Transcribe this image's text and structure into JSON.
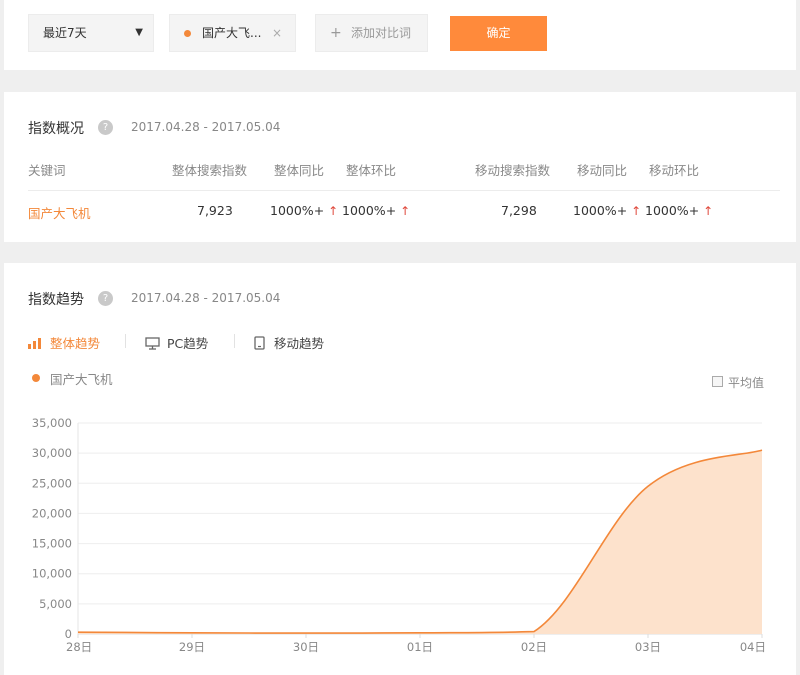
{
  "toolbar": {
    "range_select": "最近7天",
    "caret": "▼",
    "keyword_chip": "国产大飞...",
    "chip_close": "×",
    "add_plus": "+",
    "add_compare": "添加对比词",
    "confirm": "确定"
  },
  "overview": {
    "title": "指数概况",
    "help": "?",
    "date_range": "2017.04.28 - 2017.05.04",
    "headers": [
      "关键词",
      "整体搜索指数",
      "整体同比",
      "整体环比",
      "移动搜索指数",
      "移动同比",
      "移动环比"
    ],
    "row": {
      "keyword": "国产大飞机",
      "overall_index": "7,923",
      "overall_yoy": "1000%+",
      "overall_mom": "1000%+",
      "mobile_index": "7,298",
      "mobile_yoy": "1000%+",
      "mobile_mom": "1000%+",
      "up_arrow": "↑"
    }
  },
  "trend": {
    "title": "指数趋势",
    "help": "?",
    "date_range": "2017.04.28 - 2017.05.04",
    "tabs": [
      {
        "label": "整体趋势",
        "icon": "bar-chart-icon"
      },
      {
        "label": "PC趋势",
        "icon": "monitor-icon"
      },
      {
        "label": "移动趋势",
        "icon": "mobile-icon"
      }
    ],
    "legend": "国产大飞机",
    "average_label": "平均值"
  },
  "colors": {
    "accent": "#f3883a",
    "button": "#ff8a3b",
    "up_arrow": "#e0483b",
    "area_fill": "#fde2cc"
  },
  "chart_data": {
    "type": "area",
    "x": [
      "28日",
      "29日",
      "30日",
      "01日",
      "02日",
      "03日",
      "04日"
    ],
    "series": [
      {
        "name": "国产大飞机",
        "values": [
          300,
          200,
          150,
          200,
          400,
          24500,
          30500
        ]
      }
    ],
    "ylim": [
      0,
      35000
    ],
    "yticks": [
      "0",
      "5,000",
      "10,000",
      "15,000",
      "20,000",
      "25,000",
      "30,000",
      "35,000"
    ],
    "grid": true,
    "legend_position": "top-left"
  }
}
